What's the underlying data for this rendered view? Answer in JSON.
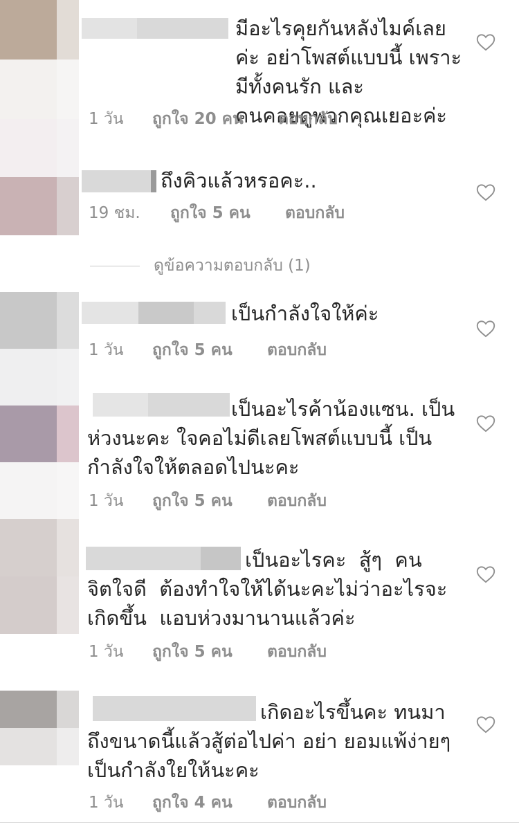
{
  "comments": [
    {
      "text": "มีอะไรคุยกันหลังไมค์เลย\nค่ะ อย่าโพสต์แบบนี้ เพราะมีทั้งคนรัก และ\nคนคอยดูพวกคุณเยอะค่ะ",
      "time": "1 วัน",
      "likes": "ถูกใจ 20 คน",
      "reply": "ตอบกลับ"
    },
    {
      "text": "ถึงคิวแล้วหรอคะ..",
      "time": "19 ชม.",
      "likes": "ถูกใจ 5 คน",
      "reply": "ตอบกลับ"
    },
    {
      "text": "เป็นกำลังใจให้ค่ะ",
      "time": "1 วัน",
      "likes": "ถูกใจ 5 คน",
      "reply": "ตอบกลับ"
    },
    {
      "text": "เป็นอะไรค้าน้องแซน. เป็น\nห่วงนะคะ ใจคอไม่ดีเลยโพสต์แบบนี้ เป็น\nกำลังใจให้ตลอดไปนะคะ",
      "time": "1 วัน",
      "likes": "ถูกใจ 5 คน",
      "reply": "ตอบกลับ"
    },
    {
      "text": "เป็นอะไรคะ  สู้ๆ  คน\nจิตใจดี  ต้องทำใจให้ได้นะคะไม่ว่าอะไรจะ\nเกิดขึ้น  แอบห่วงมานานแล้วค่ะ",
      "time": "1 วัน",
      "likes": "ถูกใจ 5 คน",
      "reply": "ตอบกลับ"
    },
    {
      "text": "เกิดอะไรขึ้นคะ ทนมา\nถึงขนาดนี้แล้วสู้ต่อไปค่า อย่า ยอมแพ้ง่ายๆ\nเป็นกำลังใยให้นะคะ",
      "time": "1 วัน",
      "likes": "ถูกใจ 4 คน",
      "reply": "ตอบกลับ"
    }
  ],
  "view_replies": "ดูข้อความตอบกลับ (1)",
  "icons": {
    "like": "heart-outline-icon"
  },
  "colors": {
    "text": "#262626",
    "meta": "#8e8e8e",
    "redaction": "#d9d9d9"
  }
}
